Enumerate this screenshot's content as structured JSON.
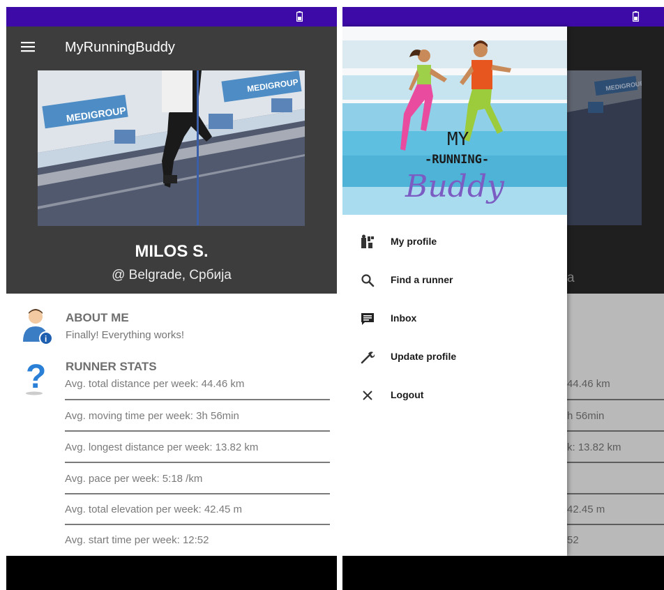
{
  "left_screen": {
    "app_title": "MyRunningBuddy",
    "profile": {
      "name": "MILOS S.",
      "location": "@ Belgrade, Србија",
      "banner_texts": [
        "MEDIGROUP",
        "MEDIGROUP",
        "MEDIGROUP"
      ]
    },
    "about": {
      "title": "ABOUT ME",
      "text": "Finally! Everything works!"
    },
    "stats": {
      "title": "RUNNER STATS",
      "rows": [
        "Avg. total distance per week: 44.46 km",
        "Avg. moving time per week: 3h 56min",
        "Avg. longest distance per week: 13.82 km",
        "Avg. pace per week: 5:18 /km",
        "Avg. total elevation per week: 42.45 m",
        "Avg. start time per week: 12:52"
      ]
    }
  },
  "right_screen": {
    "logo": {
      "line1": "MY",
      "line2": "-RUNNING-",
      "line3": "Buddy"
    },
    "menu": [
      {
        "label": "My profile",
        "icon": "profile-icon"
      },
      {
        "label": "Find a runner",
        "icon": "search-icon"
      },
      {
        "label": "Inbox",
        "icon": "inbox-icon"
      },
      {
        "label": "Update profile",
        "icon": "wrench-icon"
      },
      {
        "label": "Logout",
        "icon": "close-icon"
      }
    ],
    "dimmed_background": {
      "location_fragment": "a",
      "stat_fragments": [
        "44.46 km",
        "h 56min",
        "k: 13.82 km",
        "42.45 m",
        "52"
      ]
    }
  },
  "colors": {
    "status_bar": "#3d0aa8",
    "app_bar": "#3d3d3d",
    "nav_bar": "#000000"
  }
}
